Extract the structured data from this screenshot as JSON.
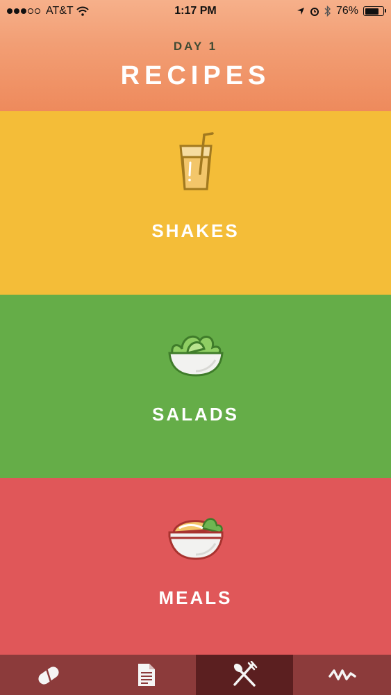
{
  "status_bar": {
    "carrier": "AT&T",
    "time": "1:17 PM",
    "battery": "76%",
    "battery_level": 0.76
  },
  "header": {
    "day": "DAY 1",
    "title": "RECIPES"
  },
  "categories": [
    {
      "label": "SHAKES",
      "icon": "shake-glass-icon",
      "color": "#f4bd38"
    },
    {
      "label": "SALADS",
      "icon": "salad-bowl-icon",
      "color": "#65ad48"
    },
    {
      "label": "MEALS",
      "icon": "meal-bowl-icon",
      "color": "#e05759"
    }
  ],
  "tab_bar": {
    "tabs": [
      {
        "icon": "pill-icon",
        "active": false
      },
      {
        "icon": "document-icon",
        "active": false
      },
      {
        "icon": "fork-spoon-icon",
        "active": true
      },
      {
        "icon": "activity-icon",
        "active": false
      }
    ],
    "active_color": "#5b1f20",
    "color": "#8c3b3b"
  }
}
